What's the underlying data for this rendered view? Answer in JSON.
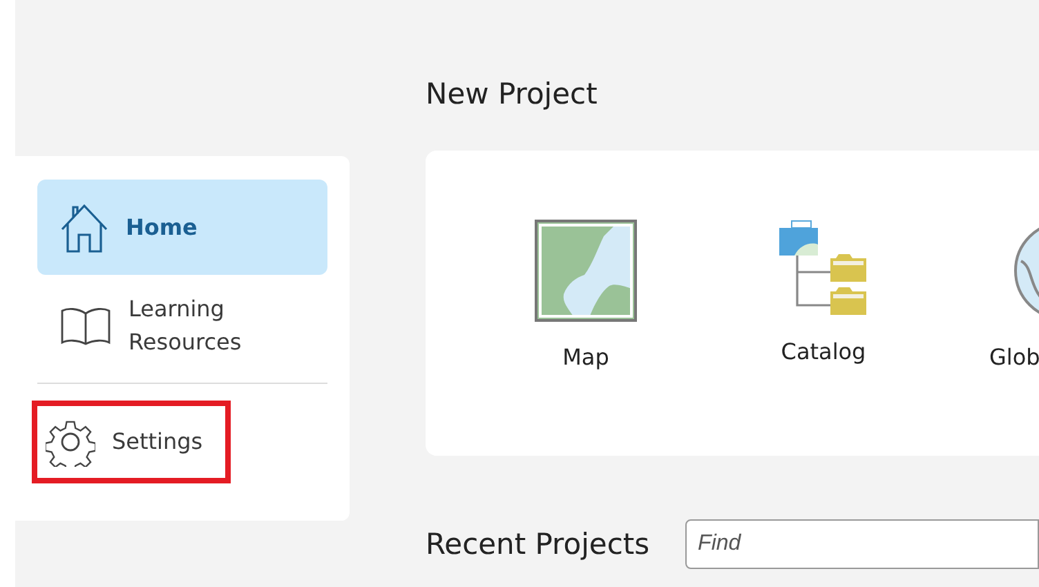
{
  "sidebar": {
    "items": [
      {
        "kind": "home",
        "label": "Home",
        "selected": true,
        "highlighted": false
      },
      {
        "kind": "book",
        "label": "Learning Resources",
        "selected": false,
        "highlighted": false
      },
      {
        "kind": "gear",
        "label": "Settings",
        "selected": false,
        "highlighted": true
      }
    ]
  },
  "new_project": {
    "title": "New Project",
    "templates": [
      {
        "kind": "map",
        "label": "Map"
      },
      {
        "kind": "catalog",
        "label": "Catalog"
      },
      {
        "kind": "globe",
        "label": "Glob"
      }
    ]
  },
  "recent_projects": {
    "title": "Recent Projects",
    "search": {
      "placeholder": "Find"
    }
  }
}
